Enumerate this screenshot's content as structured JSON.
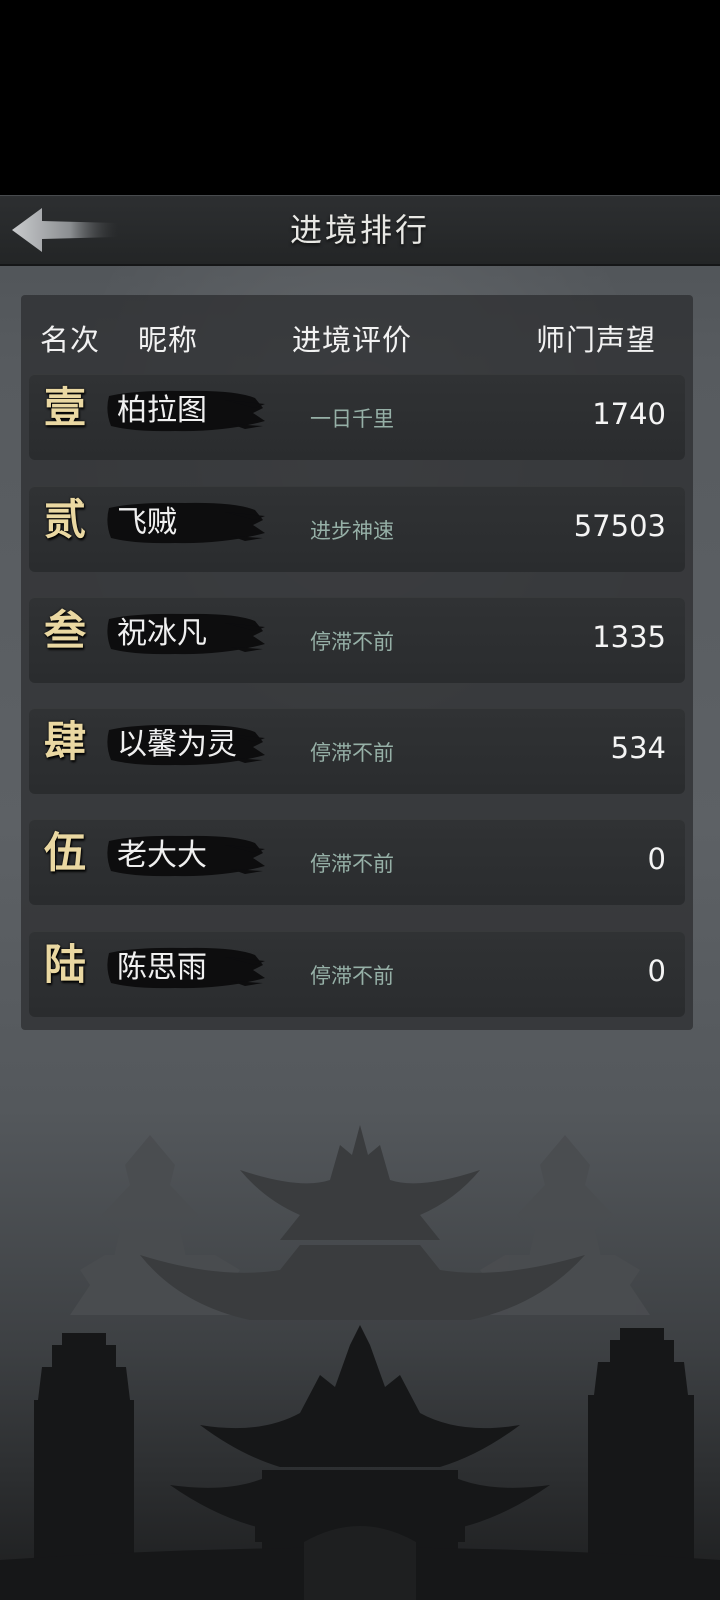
{
  "header": {
    "title": "进境排行",
    "back_icon": "back-arrow-icon"
  },
  "table": {
    "columns": {
      "rank": "名次",
      "nickname": "昵称",
      "evaluation": "进境评价",
      "prestige": "师门声望"
    },
    "rows": [
      {
        "rank": "壹",
        "nickname": "柏拉图",
        "evaluation": "一日千里",
        "prestige": "1740"
      },
      {
        "rank": "贰",
        "nickname": "飞贼",
        "evaluation": "进步神速",
        "prestige": "57503"
      },
      {
        "rank": "叁",
        "nickname": "祝冰凡",
        "evaluation": "停滞不前",
        "prestige": "1335"
      },
      {
        "rank": "肆",
        "nickname": "以馨为灵",
        "evaluation": "停滞不前",
        "prestige": "534"
      },
      {
        "rank": "伍",
        "nickname": "老大大",
        "evaluation": "停滞不前",
        "prestige": "0"
      },
      {
        "rank": "陆",
        "nickname": "陈思雨",
        "evaluation": "停滞不前",
        "prestige": "0"
      }
    ]
  },
  "colors": {
    "rank_gold": "#ead8a2",
    "evaluation_green": "#96b0a7",
    "panel": "#2e3032",
    "row": "#2c2e30"
  },
  "decoration": {
    "background": "temple-gate-silhouette"
  }
}
